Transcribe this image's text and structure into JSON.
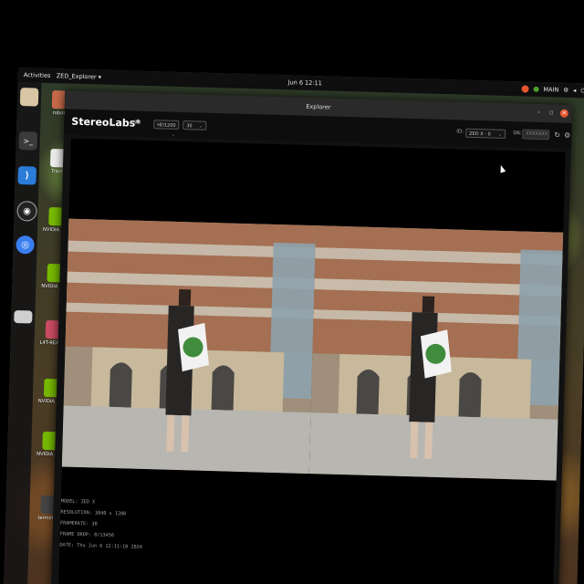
{
  "topbar": {
    "activities": "Activities",
    "app_menu": "ZED_Explorer ▾",
    "clock": "Jun 6  12:11",
    "tray_label": "MAIN"
  },
  "desktop": {
    "icons": [
      {
        "label": "robot",
        "icon": "home-folder-icon"
      },
      {
        "label": "Trash",
        "icon": "trash-icon"
      },
      {
        "label": "NVIDIA Jetson Community",
        "icon": "nvidia-icon"
      },
      {
        "label": "NVIDIA Jetson Zoo",
        "icon": "nvidia-icon"
      },
      {
        "label": "L4T-README",
        "icon": "readme-icon"
      },
      {
        "label": "NVIDIA Jetson Developer Z",
        "icon": "nvidia-icon"
      },
      {
        "label": "NVIDIA Jetson Support",
        "icon": "nvidia-icon"
      },
      {
        "label": "terminal",
        "icon": "terminal-file-icon"
      }
    ]
  },
  "dock": {
    "items": [
      {
        "name": "files-icon",
        "color": "#d9c5a3"
      },
      {
        "name": "terminal-icon",
        "color": "#3b3b3b"
      },
      {
        "name": "vscode-icon",
        "color": "#2b7bd9"
      },
      {
        "name": "obs-icon",
        "color": "#222222"
      },
      {
        "name": "chromium-icon",
        "color": "#3a7ff0"
      },
      {
        "name": "disk-icon",
        "color": "#cfcfcf"
      }
    ]
  },
  "window": {
    "title": "Explorer",
    "brand": "StereoLabs*",
    "live": "LIVE",
    "resolution_select": "HD1200",
    "fps_select": "30",
    "camera_label": "ID:",
    "camera_select": "ZED X - 0",
    "sn_label": "SN:",
    "sn_value": "XXXXXXX"
  },
  "info": {
    "model": "MODEL: ZED X",
    "resolution": "RESOLUTION: 3840 x 1200",
    "framerate": "FRAMERATE: 30",
    "frame_drop": "FRAME DROP: 0/13456",
    "date": "DATE: Thu Jun 6 12:11:10 2024"
  },
  "colors": {
    "accent": "#e4572e",
    "topbar": "#0f0f10",
    "window_bg": "#111111"
  }
}
